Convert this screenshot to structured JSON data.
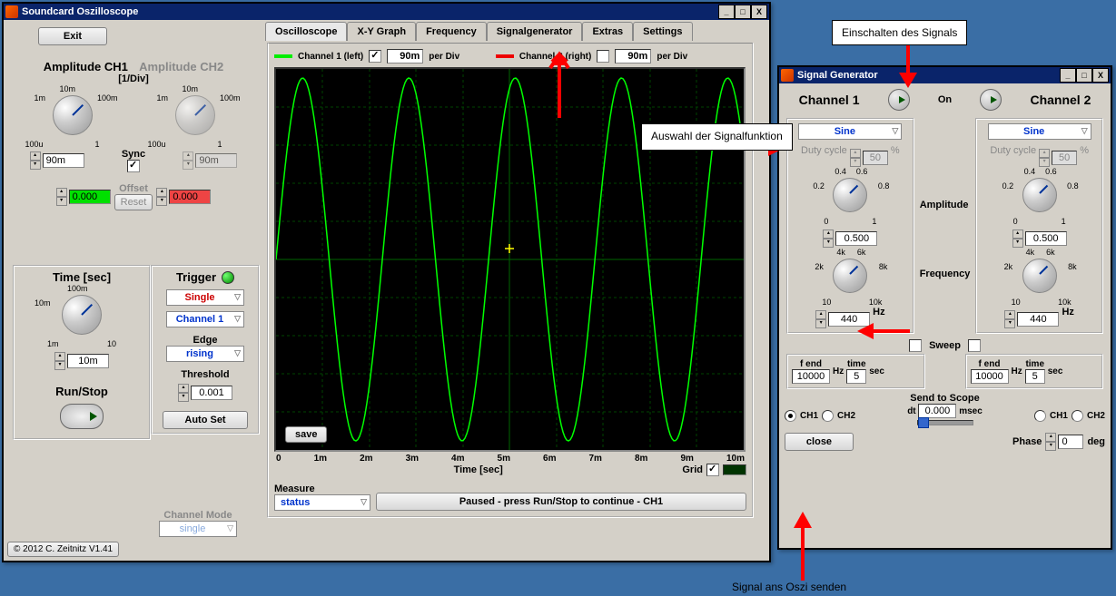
{
  "main_window": {
    "title": "Soundcard Oszilloscope",
    "exit_btn": "Exit",
    "copyright": "© 2012   C. Zeitnitz V1.41",
    "amplitude_ch1_label": "Amplitude CH1",
    "amplitude_ch2_label": "Amplitude CH2",
    "div_label": "[1/Div]",
    "knob_ticks": {
      "t10m": "10m",
      "t1m": "1m",
      "t100m": "100m",
      "t1": "1",
      "t100u": "100u"
    },
    "amp1_value": "90m",
    "amp2_value": "90m",
    "sync_label": "Sync",
    "offset_label": "Offset",
    "offset1_value": "0.000",
    "offset2_value": "0.000",
    "reset_btn": "Reset",
    "time_label": "Time [sec]",
    "time_ticks": {
      "t100m": "100m",
      "t10m": "10m",
      "t1m": "1m",
      "t10": "10"
    },
    "time_value": "10m",
    "runstop_label": "Run/Stop",
    "trigger_label": "Trigger",
    "trigger_mode": "Single",
    "trigger_channel": "Channel 1",
    "edge_label": "Edge",
    "edge_value": "rising",
    "threshold_label": "Threshold",
    "threshold_value": "0.001",
    "autoset_btn": "Auto Set",
    "channel_mode_label": "Channel Mode",
    "channel_mode_value": "single",
    "tabs": {
      "oscilloscope": "Oscilloscope",
      "xygraph": "X-Y Graph",
      "frequency": "Frequency",
      "signalgenerator": "Signalgenerator",
      "extras": "Extras",
      "settings": "Settings"
    },
    "ch1_legend": "Channel 1 (left)",
    "ch2_legend": "Channel 2 (right)",
    "ch1_div": "90m",
    "ch2_div": "90m",
    "per_div": "per Div",
    "save_btn": "save",
    "xaxis_label": "Time [sec]",
    "xticks": [
      "0",
      "1m",
      "2m",
      "3m",
      "4m",
      "5m",
      "6m",
      "7m",
      "8m",
      "9m",
      "10m"
    ],
    "grid_label": "Grid",
    "measure_label": "Measure",
    "measure_status": "status",
    "status_msg": "Paused - press Run/Stop to continue - CH1"
  },
  "signal_gen": {
    "title": "Signal Generator",
    "ch1_label": "Channel 1",
    "ch2_label": "Channel 2",
    "on_label": "On",
    "waveform": "Sine",
    "duty_label": "Duty cycle",
    "duty_value": "50",
    "percent": "%",
    "amplitude_label": "Amplitude",
    "amp_ticks": {
      "t0": "0",
      "t02": "0.2",
      "t04": "0.4",
      "t06": "0.6",
      "t08": "0.8",
      "t1": "1"
    },
    "amp_value": "0.500",
    "freq_label": "Frequency",
    "freq_ticks": {
      "t10": "10",
      "t2k": "2k",
      "t4k": "4k",
      "t6k": "6k",
      "t8k": "8k",
      "t10k": "10k"
    },
    "freq_value": "440",
    "hz": "Hz",
    "sweep_label": "Sweep",
    "fend_label": "f end",
    "fend_value": "10000",
    "time_label": "time",
    "time_value": "5",
    "sec": "sec",
    "send_scope": "Send to Scope",
    "ch1_radio": "CH1",
    "ch2_radio": "CH2",
    "dt_label": "dt",
    "dt_value": "0.000",
    "msec": "msec",
    "close_btn": "close",
    "phase_label": "Phase",
    "phase_value": "0",
    "deg": "deg"
  },
  "annotations": {
    "einschalten": "Einschalten des Signals",
    "auswahl": "Auswahl der Signalfunktion",
    "signal_senden": "Signal ans Oszi senden"
  },
  "chart_data": {
    "type": "line",
    "title": "",
    "xlabel": "Time [sec]",
    "ylabel": "",
    "xlim": [
      0,
      0.01
    ],
    "ylim": [
      -0.09,
      0.09
    ],
    "series": [
      {
        "name": "Channel 1",
        "color": "#00ff00",
        "wave": "sine",
        "frequency": 440,
        "amplitude": 0.088,
        "phase": 0
      }
    ],
    "xticks": [
      0,
      0.001,
      0.002,
      0.003,
      0.004,
      0.005,
      0.006,
      0.007,
      0.008,
      0.009,
      0.01
    ],
    "grid": true
  }
}
